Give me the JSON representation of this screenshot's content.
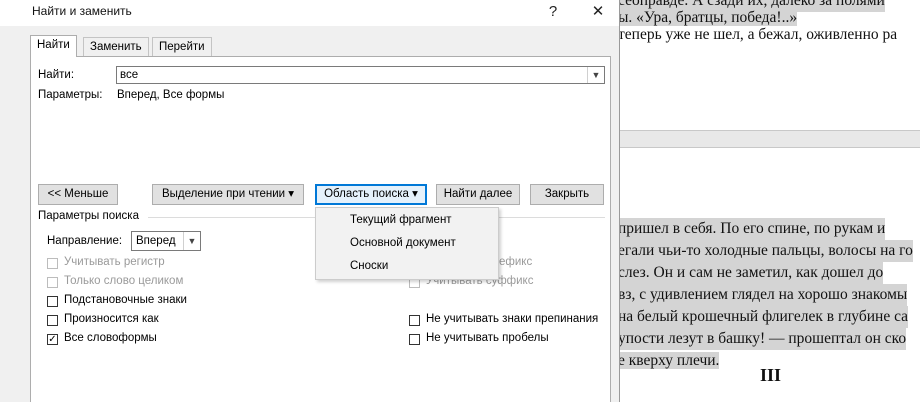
{
  "document": {
    "lines": [
      {
        "text": "сеоправде. А сзади их, далеко за полями",
        "highlight": true
      },
      {
        "text": "ы. «Ура, братцы, победа!..»",
        "highlight": true
      },
      {
        "text": "теперь уже не шел, а бежал, оживленно ра",
        "highlight": false
      },
      {
        "text": "пришел в себя. По его спине, по рукам и",
        "highlight": true
      },
      {
        "text": "егали чьи-то холодные пальцы, волосы на го",
        "highlight": true
      },
      {
        "text": "слез. Он и сам не заметил, как дошел до",
        "highlight": true
      },
      {
        "text": "вз, с удивлением глядел на хорошо знакомы",
        "highlight": true
      },
      {
        "text": "на белый крошечный флигелек в глубине са",
        "highlight": true
      },
      {
        "text": "упости лезут в башку! — прошептал он ско",
        "highlight": true
      },
      {
        "text": "е кверху плечи.",
        "highlight": true
      }
    ],
    "section_mark": "III"
  },
  "dialog": {
    "title": "Найти и заменить",
    "help": "?",
    "close": "✕",
    "tabs": [
      "Найти",
      "Заменить",
      "Перейти"
    ],
    "find_label": "Найти:",
    "find_value": "все",
    "params_label": "Параметры:",
    "params_value": "Вперед, Все формы",
    "buttons": {
      "less": "<< Меньше",
      "reading_highlight": "Выделение при чтении ▾",
      "search_area": "Область поиска ▾",
      "find_next": "Найти далее",
      "close": "Закрыть"
    },
    "search_options_label": "Параметры поиска",
    "direction_label": "Направление:",
    "direction_value": "Вперед",
    "options_left": [
      {
        "label": "Учитывать регистр",
        "checked": false,
        "enabled": false
      },
      {
        "label": "Только слово целиком",
        "checked": false,
        "enabled": false
      },
      {
        "label": "Подстановочные знаки",
        "checked": false,
        "enabled": true
      },
      {
        "label": "Произносится как",
        "checked": false,
        "enabled": true
      },
      {
        "label": "Все словоформы",
        "checked": true,
        "enabled": true
      }
    ],
    "options_right": [
      {
        "label": "ефикс",
        "checked": false,
        "enabled": false
      },
      {
        "label": "Учитывать суффикс",
        "checked": false,
        "enabled": false
      },
      {
        "label": "Не учитывать знаки препинания",
        "checked": false,
        "enabled": true
      },
      {
        "label": "Не учитывать пробелы",
        "checked": false,
        "enabled": true
      }
    ]
  },
  "menu": {
    "items": [
      "Текущий фрагмент",
      "Основной документ",
      "Сноски"
    ]
  }
}
